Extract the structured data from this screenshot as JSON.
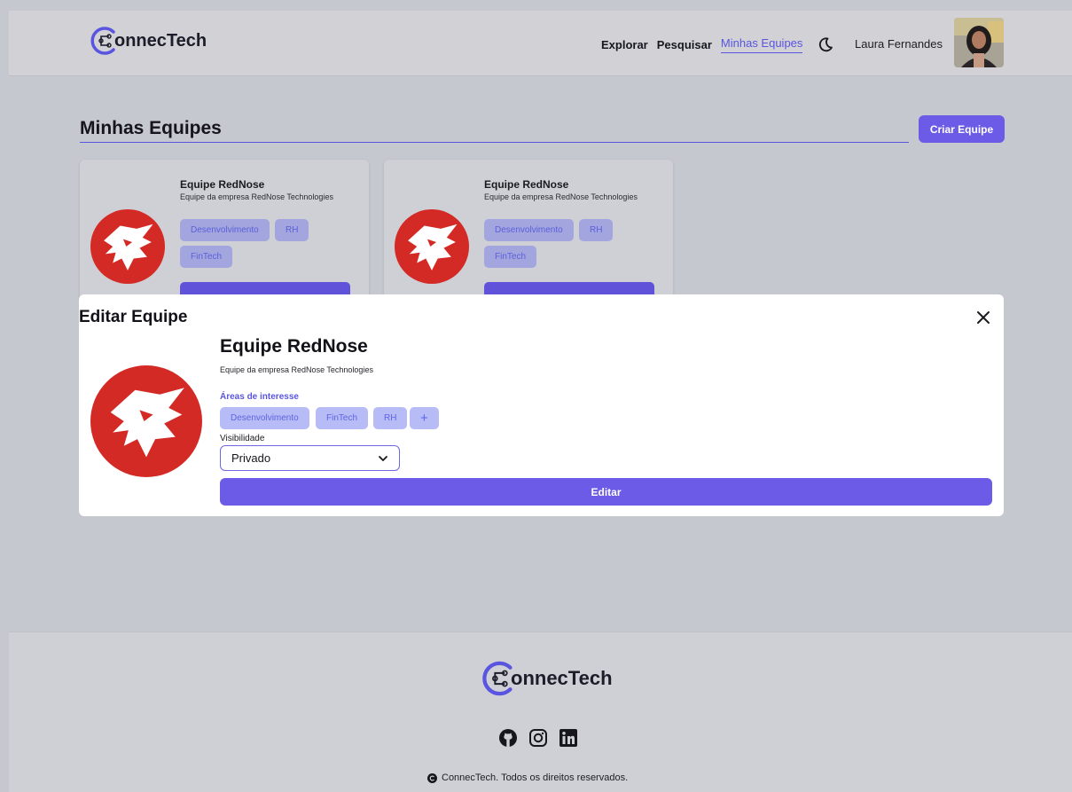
{
  "brand": {
    "name": "onnecTech",
    "accent": "#5a55e0",
    "button": "#6b5be6"
  },
  "nav": {
    "items": [
      {
        "label": "Explorar"
      },
      {
        "label": "Pesquisar"
      },
      {
        "label": "Minhas Equipes"
      }
    ],
    "theme_icon": "moon-icon"
  },
  "user": {
    "name": "Laura Fernandes"
  },
  "page": {
    "title": "Minhas Equipes",
    "create_label": "Criar Equipe"
  },
  "cards": [
    {
      "name": "Equipe RedNose",
      "description": "Equipe da empresa RedNose Technologies",
      "tags": [
        "Desenvolvimento",
        "RH",
        "FinTech"
      ]
    },
    {
      "name": "Equipe RedNose",
      "description": "Equipe da empresa RedNose Technologies",
      "tags": [
        "Desenvolvimento",
        "RH",
        "FinTech"
      ]
    }
  ],
  "modal": {
    "title": "Editar Equipe",
    "team_name": "Equipe RedNose",
    "description": "Equipe da empresa RedNose Technologies",
    "interests_label": "Áreas de interesse",
    "interests": [
      "Desenvolvimento",
      "FinTech",
      "RH"
    ],
    "add_label": "+",
    "visibility_label": "Visibilidade",
    "visibility_value": "Privado",
    "submit_label": "Editar"
  },
  "footer": {
    "icons": [
      "github-icon",
      "instagram-icon",
      "linkedin-icon"
    ],
    "copyright": "ConnecTech. Todos os direitos reservados."
  }
}
